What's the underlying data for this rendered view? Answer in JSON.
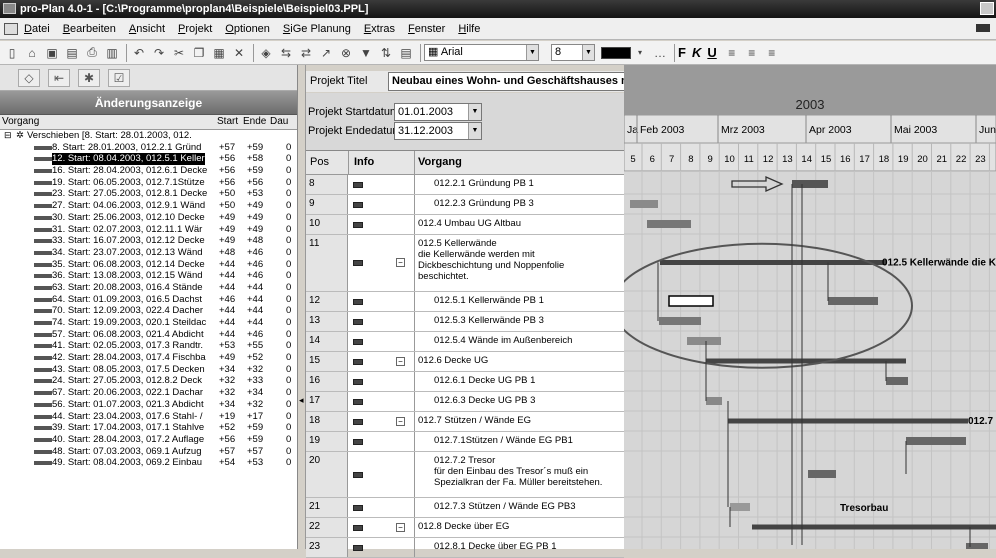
{
  "window": {
    "title": "pro-Plan 4.0-1 - [C:\\Programme\\proplan4\\Beispiele\\Beispiel03.PPL]"
  },
  "menu": [
    "Datei",
    "Bearbeiten",
    "Ansicht",
    "Projekt",
    "Optionen",
    "SiGe Planung",
    "Extras",
    "Fenster",
    "Hilfe"
  ],
  "toolbar": {
    "font": "Arial",
    "size": "8",
    "bold": "F",
    "italic": "K",
    "underline": "U"
  },
  "left": {
    "title": "Änderungsanzeige",
    "headers": {
      "vorgang": "Vorgang",
      "start": "Start",
      "ende": "Ende",
      "dau": "Dau"
    },
    "root": "Verschieben [8. Start: 28.01.2003, 012.",
    "rows": [
      {
        "t": "8. Start: 28.01.2003, 012.2.1 Gründ",
        "s": "+57",
        "e": "+59",
        "d": "0"
      },
      {
        "t": "12. Start: 08.04.2003, 012.5.1 Keller",
        "s": "+56",
        "e": "+58",
        "d": "0",
        "sel": true
      },
      {
        "t": "16. Start: 28.04.2003, 012.6.1 Decke",
        "s": "+56",
        "e": "+59",
        "d": "0"
      },
      {
        "t": "19. Start: 06.05.2003, 012.7.1Stütze",
        "s": "+56",
        "e": "+56",
        "d": "0"
      },
      {
        "t": "23. Start: 27.05.2003, 012.8.1 Decke",
        "s": "+50",
        "e": "+53",
        "d": "0"
      },
      {
        "t": "27. Start: 04.06.2003, 012.9.1 Wänd",
        "s": "+50",
        "e": "+49",
        "d": "0"
      },
      {
        "t": "30. Start: 25.06.2003, 012.10 Decke",
        "s": "+49",
        "e": "+49",
        "d": "0"
      },
      {
        "t": "31. Start: 02.07.2003, 012.11.1 Wär",
        "s": "+49",
        "e": "+49",
        "d": "0"
      },
      {
        "t": "33. Start: 16.07.2003, 012.12 Decke",
        "s": "+49",
        "e": "+48",
        "d": "0"
      },
      {
        "t": "34. Start: 23.07.2003, 012.13 Wänd",
        "s": "+48",
        "e": "+46",
        "d": "0"
      },
      {
        "t": "35. Start: 06.08.2003, 012.14 Decke",
        "s": "+44",
        "e": "+46",
        "d": "0"
      },
      {
        "t": "36. Start: 13.08.2003, 012.15 Wänd",
        "s": "+44",
        "e": "+46",
        "d": "0"
      },
      {
        "t": "63. Start: 20.08.2003, 016.4 Stände",
        "s": "+44",
        "e": "+44",
        "d": "0"
      },
      {
        "t": "64. Start: 01.09.2003, 016.5 Dachst",
        "s": "+46",
        "e": "+44",
        "d": "0"
      },
      {
        "t": "70. Start: 12.09.2003, 022.4 Dacher",
        "s": "+44",
        "e": "+44",
        "d": "0"
      },
      {
        "t": "74. Start: 19.09.2003, 020.1 Steildac",
        "s": "+44",
        "e": "+44",
        "d": "0"
      },
      {
        "t": "57. Start: 06.08.2003, 021.4 Abdicht",
        "s": "+44",
        "e": "+46",
        "d": "0"
      },
      {
        "t": "41. Start: 02.05.2003, 017.3 Randtr.",
        "s": "+53",
        "e": "+55",
        "d": "0"
      },
      {
        "t": "42. Start: 28.04.2003, 017.4 Fischba",
        "s": "+49",
        "e": "+52",
        "d": "0"
      },
      {
        "t": "43. Start: 08.05.2003, 017.5 Decken",
        "s": "+34",
        "e": "+32",
        "d": "0"
      },
      {
        "t": "24. Start: 27.05.2003, 012.8.2 Deck",
        "s": "+32",
        "e": "+33",
        "d": "0"
      },
      {
        "t": "67. Start: 20.06.2003, 022.1 Dachar",
        "s": "+32",
        "e": "+34",
        "d": "0"
      },
      {
        "t": "56. Start: 01.07.2003, 021.3 Abdicht",
        "s": "+34",
        "e": "+32",
        "d": "0"
      },
      {
        "t": "44. Start: 23.04.2003, 017.6 Stahl- /",
        "s": "+19",
        "e": "+17",
        "d": "0"
      },
      {
        "t": "39. Start: 17.04.2003, 017.1 Stahlve",
        "s": "+52",
        "e": "+59",
        "d": "0"
      },
      {
        "t": "40. Start: 28.04.2003, 017.2 Auflage",
        "s": "+56",
        "e": "+59",
        "d": "0"
      },
      {
        "t": "48. Start: 07.03.2003, 069.1 Aufzug",
        "s": "+57",
        "e": "+57",
        "d": "0"
      },
      {
        "t": "49. Start: 08.04.2003, 069.2 Einbau",
        "s": "+54",
        "e": "+53",
        "d": "0"
      }
    ]
  },
  "project": {
    "title_label": "Projekt Titel",
    "title": "Neubau eines Wohn- und Geschäftshauses mit Tresorraum in Testhausen",
    "start_label": "Projekt Startdatum",
    "start": "01.01.2003",
    "end_label": "Projekt Endedatum",
    "end": "31.12.2003"
  },
  "grid": {
    "headers": {
      "pos": "Pos",
      "info": "Info",
      "vorgang": "Vorgang"
    },
    "rows": [
      {
        "pos": "8",
        "v": "012.2.1 Gründung PB 1",
        "h": 20,
        "ind": 1
      },
      {
        "pos": "9",
        "v": "012.2.3 Gründung PB 3",
        "h": 20,
        "ind": 1
      },
      {
        "pos": "10",
        "v": "012.4 Umbau UG Altbau",
        "h": 20,
        "ind": 0
      },
      {
        "pos": "11",
        "v": "012.5 Kellerwände\ndie Kellerwände werden mit\nDickbeschichtung und Noppenfolie\nbeschichtet.",
        "h": 57,
        "ind": 0,
        "pm": "−"
      },
      {
        "pos": "12",
        "v": "012.5.1 Kellerwände PB 1",
        "h": 20,
        "ind": 1
      },
      {
        "pos": "13",
        "v": "012.5.3 Kellerwände PB 3",
        "h": 20,
        "ind": 1
      },
      {
        "pos": "14",
        "v": "012.5.4 Wände im Außenbereich",
        "h": 20,
        "ind": 1
      },
      {
        "pos": "15",
        "v": "012.6 Decke UG",
        "h": 20,
        "ind": 0,
        "pm": "−"
      },
      {
        "pos": "16",
        "v": "012.6.1 Decke UG PB 1",
        "h": 20,
        "ind": 1
      },
      {
        "pos": "17",
        "v": "012.6.3 Decke UG PB 3",
        "h": 20,
        "ind": 1
      },
      {
        "pos": "18",
        "v": "012.7 Stützen / Wände EG",
        "h": 20,
        "ind": 0,
        "pm": "−"
      },
      {
        "pos": "19",
        "v": "012.7.1Stützen / Wände EG PB1",
        "h": 20,
        "ind": 1
      },
      {
        "pos": "20",
        "v": "012.7.2 Tresor\nfür den Einbau des Tresor´s muß ein\nSpezialkran der Fa. Müller bereitstehen.",
        "h": 46,
        "ind": 1
      },
      {
        "pos": "21",
        "v": "012.7.3 Stützen / Wände EG PB3",
        "h": 20,
        "ind": 1
      },
      {
        "pos": "22",
        "v": "012.8 Decke über EG",
        "h": 20,
        "ind": 0,
        "pm": "−"
      },
      {
        "pos": "23",
        "v": "012.8.1 Decke über EG PB 1",
        "h": 20,
        "ind": 1
      }
    ]
  },
  "gantt": {
    "year": "2003",
    "months": [
      "Ja",
      "Feb 2003",
      "Mrz 2003",
      "Apr 2003",
      "Mai 2003",
      "Jun"
    ],
    "weeks": [
      "5",
      "6",
      "7",
      "8",
      "9",
      "10",
      "11",
      "12",
      "13",
      "14",
      "15",
      "16",
      "17",
      "18",
      "19",
      "20",
      "21",
      "22",
      "23"
    ],
    "labels": {
      "kellerwaende": "012.5 Kellerwände die K",
      "stuetzen": "012.7",
      "tresor": "Tresorbau"
    }
  }
}
